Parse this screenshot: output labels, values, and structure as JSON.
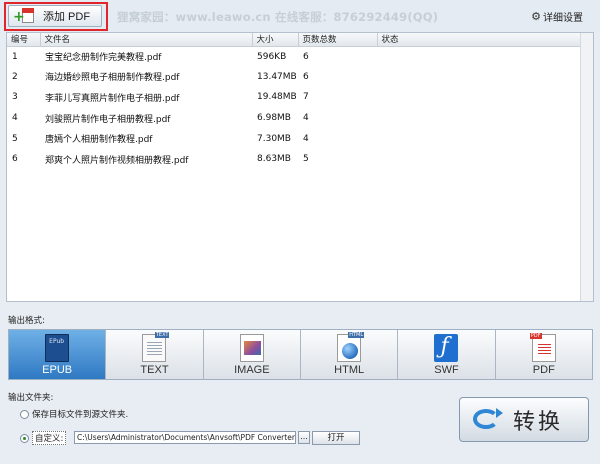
{
  "toolbar": {
    "add_pdf_label": "添加 PDF",
    "brand_text": "狸窝家园：www.leawo.cn     在线客服：876292449(QQ)",
    "settings_label": "详细设置"
  },
  "table": {
    "columns": [
      "编号",
      "文件名",
      "大小",
      "页数总数",
      "状态"
    ],
    "rows": [
      {
        "num": "1",
        "name": "宝宝纪念册制作完美教程.pdf",
        "size": "596KB",
        "pages": "6",
        "status": ""
      },
      {
        "num": "2",
        "name": "海边婚纱照电子相册制作教程.pdf",
        "size": "13.47MB",
        "pages": "6",
        "status": ""
      },
      {
        "num": "3",
        "name": "李菲儿写真照片制作电子相册.pdf",
        "size": "19.48MB",
        "pages": "7",
        "status": ""
      },
      {
        "num": "4",
        "name": "刘骏照片制作电子相册教程.pdf",
        "size": "6.98MB",
        "pages": "4",
        "status": ""
      },
      {
        "num": "5",
        "name": "唐嫣个人相册制作教程.pdf",
        "size": "7.30MB",
        "pages": "4",
        "status": ""
      },
      {
        "num": "6",
        "name": "郑爽个人照片制作视频相册教程.pdf",
        "size": "8.63MB",
        "pages": "5",
        "status": ""
      }
    ]
  },
  "output_format": {
    "label": "输出格式:",
    "selected": "EPUB",
    "formats": [
      {
        "label": "EPUB",
        "icon": "epub-book-icon"
      },
      {
        "label": "TEXT",
        "icon": "text-document-icon"
      },
      {
        "label": "IMAGE",
        "icon": "image-icon"
      },
      {
        "label": "HTML",
        "icon": "html-globe-icon"
      },
      {
        "label": "SWF",
        "icon": "flash-icon"
      },
      {
        "label": "PDF",
        "icon": "pdf-document-icon"
      }
    ]
  },
  "output_folder": {
    "label": "输出文件夹:",
    "option_source": "保存目标文件到源文件夹.",
    "option_custom": "自定义:",
    "selected": "custom",
    "path": "C:\\Users\\Administrator\\Documents\\Anvsoft\\PDF Converter\\putput\\",
    "browse_label": "...",
    "open_label": "打开"
  },
  "convert": {
    "label": "转换"
  },
  "colors": {
    "highlight": "#e0262b",
    "active_tab": "#2f79c3",
    "accent_blue": "#2f86d4"
  }
}
